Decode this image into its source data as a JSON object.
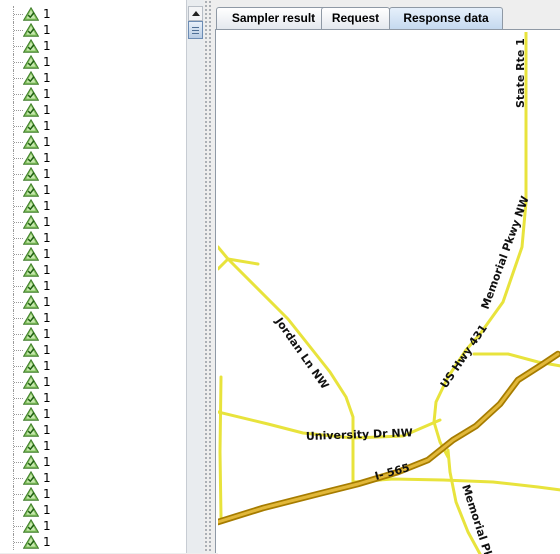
{
  "tree": {
    "node_label": "1",
    "node_count": 34
  },
  "tabs": [
    {
      "label": "Sampler result"
    },
    {
      "label": "Request"
    },
    {
      "label": "Response data"
    }
  ],
  "map": {
    "roads": {
      "state_rte": "State Rte 1",
      "memorial_pkwy": "Memorial Pkwy NW",
      "us_hwy": "US Hwy 431",
      "jordan_ln": "Jordan Ln NW",
      "university_dr": "University Dr NW",
      "interstate": "I- 565",
      "memorial_pkwy_south": "Memorial Pkwy"
    },
    "colors": {
      "minor_road": "#e8e33c",
      "highway_fill": "#e2b83a",
      "highway_border": "#a67c00",
      "label": "#111111"
    }
  }
}
